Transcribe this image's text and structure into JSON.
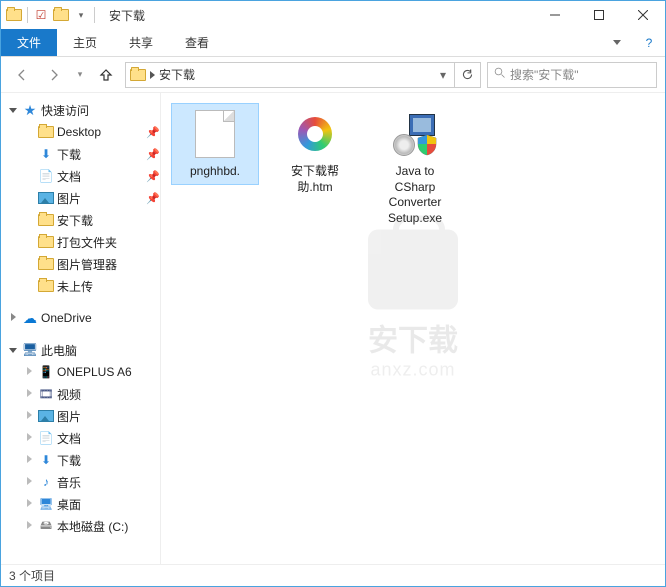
{
  "title": "安下载",
  "ribbon": {
    "file": "文件",
    "home": "主页",
    "share": "共享",
    "view": "查看"
  },
  "address": {
    "path": "安下载"
  },
  "search": {
    "placeholder": "搜索\"安下载\""
  },
  "sidebar": {
    "quick_access": "快速访问",
    "items": [
      {
        "label": "Desktop",
        "icon": "folder",
        "pinned": true
      },
      {
        "label": "下载",
        "icon": "download",
        "pinned": true
      },
      {
        "label": "文档",
        "icon": "document",
        "pinned": true
      },
      {
        "label": "图片",
        "icon": "picture",
        "pinned": true
      },
      {
        "label": "安下载",
        "icon": "folder",
        "pinned": false
      },
      {
        "label": "打包文件夹",
        "icon": "folder",
        "pinned": false
      },
      {
        "label": "图片管理器",
        "icon": "folder",
        "pinned": false
      },
      {
        "label": "未上传",
        "icon": "folder",
        "pinned": false
      }
    ],
    "onedrive": "OneDrive",
    "this_pc": "此电脑",
    "pc_items": [
      {
        "label": "ONEPLUS A6",
        "icon": "phone"
      },
      {
        "label": "视频",
        "icon": "video"
      },
      {
        "label": "图片",
        "icon": "picture"
      },
      {
        "label": "文档",
        "icon": "document"
      },
      {
        "label": "下载",
        "icon": "download"
      },
      {
        "label": "音乐",
        "icon": "music"
      },
      {
        "label": "桌面",
        "icon": "desktop"
      },
      {
        "label": "本地磁盘 (C:)",
        "icon": "disk"
      }
    ]
  },
  "files": [
    {
      "name": "pnghhbd.",
      "type": "blank",
      "selected": true
    },
    {
      "name": "安下载帮助.htm",
      "type": "htm",
      "selected": false
    },
    {
      "name": "Java to CSharp Converter Setup.exe",
      "type": "exe",
      "selected": false
    }
  ],
  "watermark": {
    "line1": "安下载",
    "line2": "anxz.com"
  },
  "status": "3 个项目"
}
